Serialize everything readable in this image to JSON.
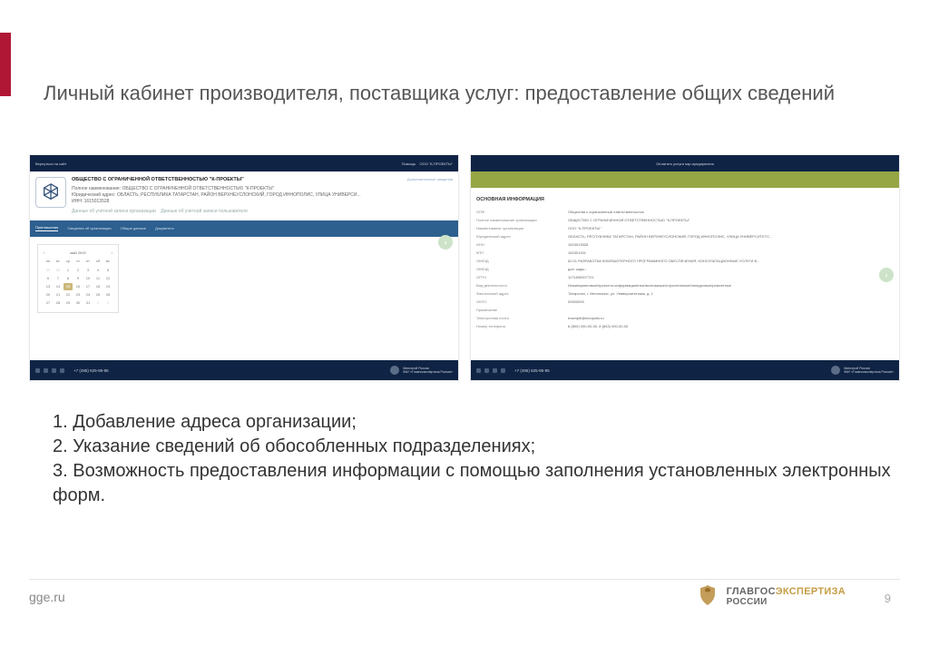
{
  "title": "Личный кабинет производителя, поставщика услуг: предоставление общих сведений",
  "shot1": {
    "topbar_left": "Вернуться на сайт",
    "topbar_right_item1": "Помощь",
    "topbar_right_item2": "ООО \"К-ПРОЕКТЫ\"",
    "org_title": "ОБЩЕСТВО С ОГРАНИЧЕННОЙ ОТВЕТСТВЕННОСТЬЮ \"К-ПРОЕКТЫ\"",
    "org_name_label": "Полное наименование:",
    "org_name_value": "ОБЩЕСТВО С ОГРАНИЧЕННОЙ ОТВЕТСТВЕННОСТЬЮ \"К-ПРОЕКТЫ\"",
    "org_addr_label": "Юридический адрес:",
    "org_addr_value": "ОБЛАСТЬ, РЕСПУБЛИКА ТАТАРСТАН, РАЙОН ВЕРХНЕУСЛОНСКИЙ, ГОРОД ИННОПОЛИС, УЛИЦА УНИВЕРСИ...",
    "org_inn_label": "ИНН:",
    "org_inn_value": "1615013528",
    "sub_link1": "Данные об учётной записи организации",
    "sub_link2": "Данные об учётной записи пользователя",
    "extra_link": "Дополнительные сведения",
    "tabs": [
      "Приглашения",
      "Сведения об организации",
      "Общие данные",
      "Документы"
    ],
    "calendar": {
      "month": "май 2019",
      "dow": [
        "пн",
        "вт",
        "ср",
        "чт",
        "пт",
        "сб",
        "вс"
      ],
      "cells": [
        {
          "n": "29",
          "m": true
        },
        {
          "n": "30",
          "m": true
        },
        {
          "n": "1"
        },
        {
          "n": "2"
        },
        {
          "n": "3"
        },
        {
          "n": "4"
        },
        {
          "n": "5"
        },
        {
          "n": "6"
        },
        {
          "n": "7"
        },
        {
          "n": "8"
        },
        {
          "n": "9"
        },
        {
          "n": "10"
        },
        {
          "n": "11"
        },
        {
          "n": "12"
        },
        {
          "n": "13"
        },
        {
          "n": "14"
        },
        {
          "n": "15",
          "sel": true
        },
        {
          "n": "16"
        },
        {
          "n": "17"
        },
        {
          "n": "18"
        },
        {
          "n": "19"
        },
        {
          "n": "20"
        },
        {
          "n": "21"
        },
        {
          "n": "22"
        },
        {
          "n": "23"
        },
        {
          "n": "24"
        },
        {
          "n": "25"
        },
        {
          "n": "26"
        },
        {
          "n": "27"
        },
        {
          "n": "28"
        },
        {
          "n": "29"
        },
        {
          "n": "30"
        },
        {
          "n": "31"
        },
        {
          "n": "1",
          "m": true
        },
        {
          "n": "2",
          "m": true
        }
      ]
    }
  },
  "shot2": {
    "band_text": "Оплатить услуги sap-предприятия",
    "section_title": "ОСНОВНАЯ ИНФОРМАЦИЯ",
    "rows": [
      {
        "label": "ОПФ",
        "value": "Общества с ограниченной ответственностью"
      },
      {
        "label": "Полное наименование организации",
        "value": "ОБЩЕСТВО С ОГРАНИЧЕННОЙ ОТВЕТСТВЕННОСТЬЮ \"К-ПРОЕКТЫ\""
      },
      {
        "label": "Наименование организации",
        "value": "ООО \"К-ПРОЕКТЫ\""
      },
      {
        "label": "Юридический адрес",
        "value": "ОБЛАСТЬ, РЕСПУБЛИКА ТАТАРСТАН, РАЙОН ВЕРХНЕУСЛОНСКИЙ, ГОРОД ИННОПОЛИС, УЛИЦА УНИВЕРСИТЕТС..."
      },
      {
        "label": "ИНН",
        "value": "1615013528"
      },
      {
        "label": "КПП",
        "value": "161501001"
      },
      {
        "label": "ОКВЭД",
        "value": "62.01 РАЗРАБОТКА КОМПЬЮТЕРНОГО ПРОГРАММНОГО ОБЕСПЕЧЕНИЯ, КОНСУЛЬТАЦИОННЫЕ УСЛУГИ В..."
      },
      {
        "label": "ОКВЭД",
        "value": "доп. коды..."
      },
      {
        "label": "ОГРН",
        "value": "1171690007721"
      },
      {
        "label": "Вид деятельности",
        "value": "Инжиниринговые/проектно-информационные/монтажные/строительные/наладочные/ремонтные"
      },
      {
        "label": "Фактический адрес",
        "value": "Татарстан, г. Иннополис, ул. Университетская, д. 1"
      },
      {
        "label": "ОКПО",
        "value": "00000000"
      },
      {
        "label": "Примечание",
        "value": ""
      },
      {
        "label": "Электронная почта",
        "value": "example@innopolis.ru"
      },
      {
        "label": "Номер телефона",
        "value": "8 (800) 000-00-00, 8 (843) 000-00-00"
      }
    ]
  },
  "shot_footer": {
    "phone": "+7 (495) 625-95-95",
    "brand_line1": "Минстрой России",
    "brand_line2": "ФАУ «Главгосэкспертиза России»"
  },
  "bullets": {
    "line1": "1. Добавление адреса организации;",
    "line2": "2. Указание сведений об обособленных подразделениях;",
    "line3": "3. Возможность предоставления информации с помощью заполнения  установленных электронных форм."
  },
  "footer": {
    "site": "gge.ru",
    "logo1": "ГЛАВГОС",
    "logo2": "ЭКСПЕРТИЗА",
    "logo_sub": "РОССИИ",
    "page": "9"
  }
}
